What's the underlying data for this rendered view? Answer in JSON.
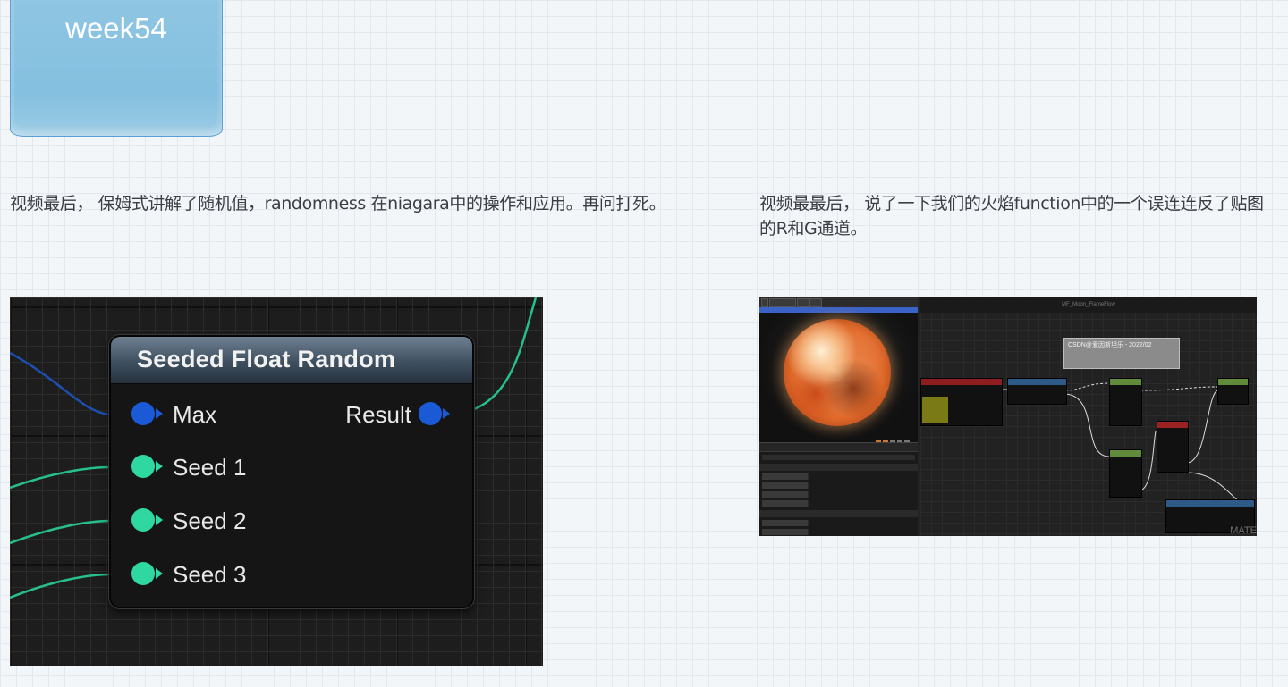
{
  "sticky_note": {
    "title": "week54"
  },
  "captions": {
    "left": "视频最后， 保姆式讲解了随机值，randomness 在niagara中的操作和应用。再问打死。",
    "right": "视频最最后， 说了一下我们的火焰function中的一个误连连反了贴图的R和G通道。"
  },
  "node_graph": {
    "node_title": "Seeded Float Random",
    "inputs": [
      "Max",
      "Seed 1",
      "Seed 2",
      "Seed 3"
    ],
    "output": "Result",
    "colors": {
      "float_pin": "#1a5ad6",
      "int_pin": "#2ed8a0"
    }
  },
  "material_editor": {
    "graph_title": "MF_Moon_FlameFlow",
    "comment_text": "CSDN@爱因斯坦乐 - 2022/02",
    "watermark": "MATE"
  }
}
